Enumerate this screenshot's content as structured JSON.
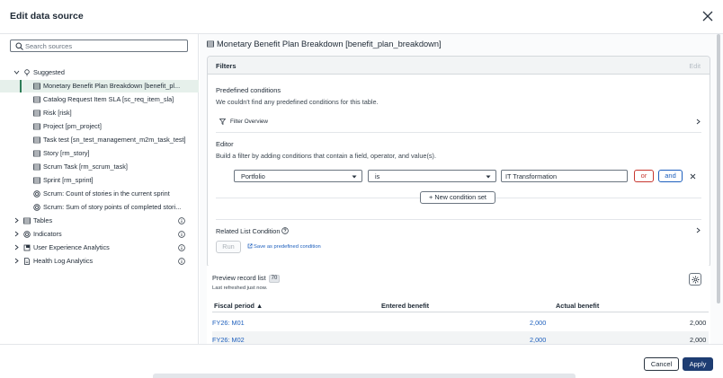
{
  "modal": {
    "title": "Edit data source"
  },
  "search": {
    "placeholder": "Search sources"
  },
  "tree": {
    "suggested_label": "Suggested",
    "suggested_items": [
      {
        "label": "Monetary Benefit Plan Breakdown [benefit_pl...",
        "icon": "table-icon"
      },
      {
        "label": "Catalog Request Item SLA [sc_req_item_sla]",
        "icon": "table-icon"
      },
      {
        "label": "Risk [risk]",
        "icon": "table-icon"
      },
      {
        "label": "Project [pm_project]",
        "icon": "table-icon"
      },
      {
        "label": "Task test [sn_test_management_m2m_task_test]",
        "icon": "table-icon"
      },
      {
        "label": "Story [rm_story]",
        "icon": "table-icon"
      },
      {
        "label": "Scrum Task [rm_scrum_task]",
        "icon": "table-icon"
      },
      {
        "label": "Sprint [rm_sprint]",
        "icon": "table-icon"
      },
      {
        "label": "Scrum: Count of stories in the current sprint",
        "icon": "indicator-icon"
      },
      {
        "label": "Scrum: Sum of story points of completed stori...",
        "icon": "indicator-icon"
      }
    ],
    "groups": [
      {
        "label": "Tables",
        "icon": "table-icon"
      },
      {
        "label": "Indicators",
        "icon": "indicator-icon"
      },
      {
        "label": "User Experience Analytics",
        "icon": "cube-icon"
      },
      {
        "label": "Health Log Analytics",
        "icon": "document-icon"
      }
    ]
  },
  "right": {
    "table_title": "Monetary Benefit Plan Breakdown [benefit_plan_breakdown]",
    "filters": {
      "title": "Filters",
      "edit_label": "Edit",
      "predefined_title": "Predefined conditions",
      "predefined_text": "We couldn't find any predefined conditions for this table.",
      "overview_label": "Filter Overview",
      "editor_title": "Editor",
      "editor_text": "Build a filter by adding conditions that contain a field, operator, and value(s).",
      "condition": {
        "field": "Portfolio",
        "operator": "is",
        "value": "IT Transformation"
      },
      "or_label": "or",
      "and_label": "and",
      "new_condition_set": "New condition set",
      "related_label": "Related List Condition",
      "run_label": "Run",
      "save_predefined": "Save as predefined condition"
    },
    "preview": {
      "title": "Preview record list",
      "count": "70",
      "refreshed": "Last refreshed just now.",
      "columns": [
        "Fiscal period",
        "Entered benefit",
        "Actual benefit"
      ],
      "rows": [
        {
          "period": "FY26: M01",
          "entered": "2,000",
          "actual": "2,000"
        },
        {
          "period": "FY26: M02",
          "entered": "2,000",
          "actual": "2,000"
        }
      ]
    }
  },
  "footer": {
    "cancel": "Cancel",
    "apply": "Apply"
  },
  "colors": {
    "primary": "#1e3d73",
    "link": "#1d5fbd",
    "selected_bg": "#e6f0eb",
    "or_red": "#c7372f"
  }
}
